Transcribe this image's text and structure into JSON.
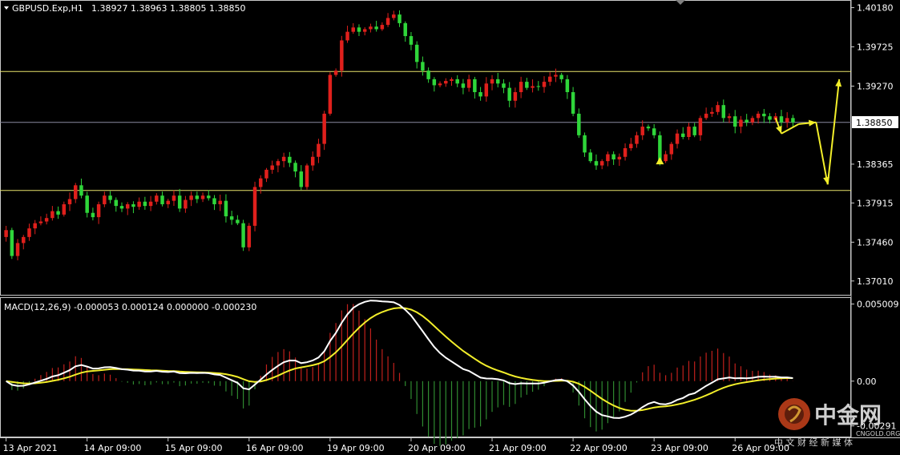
{
  "chart_header": {
    "symbol": "GBPUSD.Exp,H1",
    "ohlc": "1.38927 1.38963 1.38805 1.38850"
  },
  "indicator_header": {
    "label": "MACD(12,26,9) -0.000053 0.000124 0.000000 -0.000230"
  },
  "watermark": {
    "brand_cn": "中金网",
    "brand_en": "CNGOLD.ORG",
    "slogan": "中 文 财 经 新 媒 体"
  },
  "colors": {
    "background": "#000000",
    "bull_candle": "#e0201c",
    "bear_candle": "#2fd63a",
    "level_line": "#e7e36b",
    "current_price_line": "#8a8aa0",
    "macd_line": "#ffffff",
    "signal_line": "#f2ee2a",
    "hist_positive": "#c0201c",
    "hist_negative": "#2f8a30",
    "arrow": "#f2ee2a",
    "frame": "#c8c8c8"
  },
  "chart_data": [
    {
      "type": "candlestick",
      "symbol": "GBPUSD.Exp",
      "timeframe": "H1",
      "y_ticks": [
        "1.40180",
        "1.39725",
        "1.39270",
        "1.38365",
        "1.37915",
        "1.37460",
        "1.37010"
      ],
      "current_price_label": "1.38850",
      "ylim": [
        1.3685,
        1.4025
      ],
      "x_labels": [
        "13 Apr 2021",
        "14 Apr 09:00",
        "15 Apr 09:00",
        "16 Apr 09:00",
        "19 Apr 09:00",
        "20 Apr 09:00",
        "21 Apr 09:00",
        "22 Apr 09:00",
        "23 Apr 09:00",
        "26 Apr 09:00"
      ],
      "x_label_bar_index": [
        0,
        14,
        28,
        42,
        56,
        70,
        84,
        98,
        112,
        126
      ],
      "horizontal_levels": [
        1.3944,
        1.3885,
        1.3806
      ],
      "closes": [
        1.376,
        1.373,
        1.3745,
        1.3752,
        1.3762,
        1.3768,
        1.377,
        1.3774,
        1.3782,
        1.3778,
        1.379,
        1.3796,
        1.3812,
        1.38,
        1.378,
        1.3775,
        1.379,
        1.38,
        1.3795,
        1.3788,
        1.3785,
        1.379,
        1.3787,
        1.3793,
        1.3788,
        1.3793,
        1.38,
        1.379,
        1.3794,
        1.38,
        1.3785,
        1.3795,
        1.38,
        1.3796,
        1.38,
        1.3797,
        1.379,
        1.3794,
        1.3776,
        1.3772,
        1.3768,
        1.374,
        1.3765,
        1.381,
        1.382,
        1.383,
        1.3835,
        1.384,
        1.3845,
        1.3838,
        1.3828,
        1.381,
        1.3835,
        1.3845,
        1.386,
        1.3895,
        1.394,
        1.3945,
        1.398,
        1.399,
        1.3995,
        1.399,
        1.3993,
        1.3996,
        1.3993,
        1.3998,
        1.4006,
        1.401,
        1.4,
        1.3985,
        1.3975,
        1.3955,
        1.3945,
        1.3935,
        1.3928,
        1.393,
        1.3933,
        1.3935,
        1.393,
        1.3925,
        1.3935,
        1.392,
        1.3915,
        1.393,
        1.3935,
        1.393,
        1.3925,
        1.391,
        1.392,
        1.3932,
        1.3925,
        1.3927,
        1.3926,
        1.3932,
        1.3938,
        1.394,
        1.3935,
        1.392,
        1.3895,
        1.387,
        1.385,
        1.384,
        1.3835,
        1.384,
        1.3848,
        1.3842,
        1.3845,
        1.3855,
        1.386,
        1.387,
        1.388,
        1.3878,
        1.387,
        1.384,
        1.3848,
        1.386,
        1.3872,
        1.3868,
        1.388,
        1.387,
        1.389,
        1.3895,
        1.3897,
        1.3905,
        1.389,
        1.3892,
        1.388,
        1.3888,
        1.3885,
        1.389,
        1.3895,
        1.3892,
        1.3888,
        1.3892,
        1.3885,
        1.389,
        1.3885
      ],
      "annotations": [
        {
          "type": "up-triangle-marker",
          "bar_index": 113,
          "price": 1.384
        },
        {
          "type": "forecast-arrow-path",
          "points": [
            [
              133,
              1.389
            ],
            [
              134,
              1.3872
            ],
            [
              137,
              1.3883
            ],
            [
              140,
              1.3885
            ],
            [
              142,
              1.3813
            ],
            [
              144,
              1.3935
            ]
          ]
        }
      ]
    },
    {
      "type": "macd",
      "params": [
        12,
        26,
        9
      ],
      "y_ticks": [
        "0.005009",
        "0.00",
        "-0.00291"
      ],
      "ylim": [
        -0.0036,
        0.0054
      ]
    }
  ]
}
